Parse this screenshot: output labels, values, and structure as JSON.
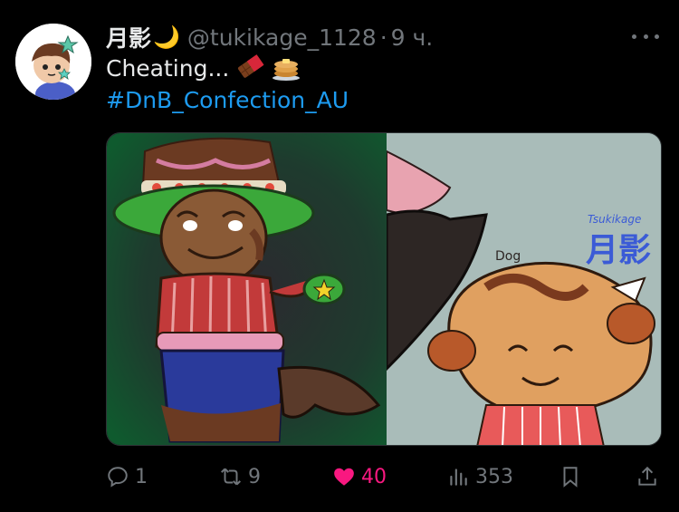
{
  "tweet": {
    "display_name": "月影",
    "name_emoji": "🌙",
    "handle": "@tukikage_1128",
    "separator": "·",
    "time": "9 ч.",
    "text": "Cheating...",
    "text_emojis": [
      "chocolate-bar",
      "pancakes"
    ],
    "hashtag": "#DnB_Confection_AU"
  },
  "media": {
    "right_watermark_top": "Tsukikage",
    "right_watermark_kanji": "月影",
    "right_label": "Dog"
  },
  "actions": {
    "reply_count": "1",
    "retweet_count": "9",
    "like_count": "40",
    "views_count": "353"
  },
  "colors": {
    "background": "#000000",
    "text": "#e7e9ea",
    "muted": "#71767b",
    "link": "#1d9bf0",
    "like": "#f91880"
  }
}
